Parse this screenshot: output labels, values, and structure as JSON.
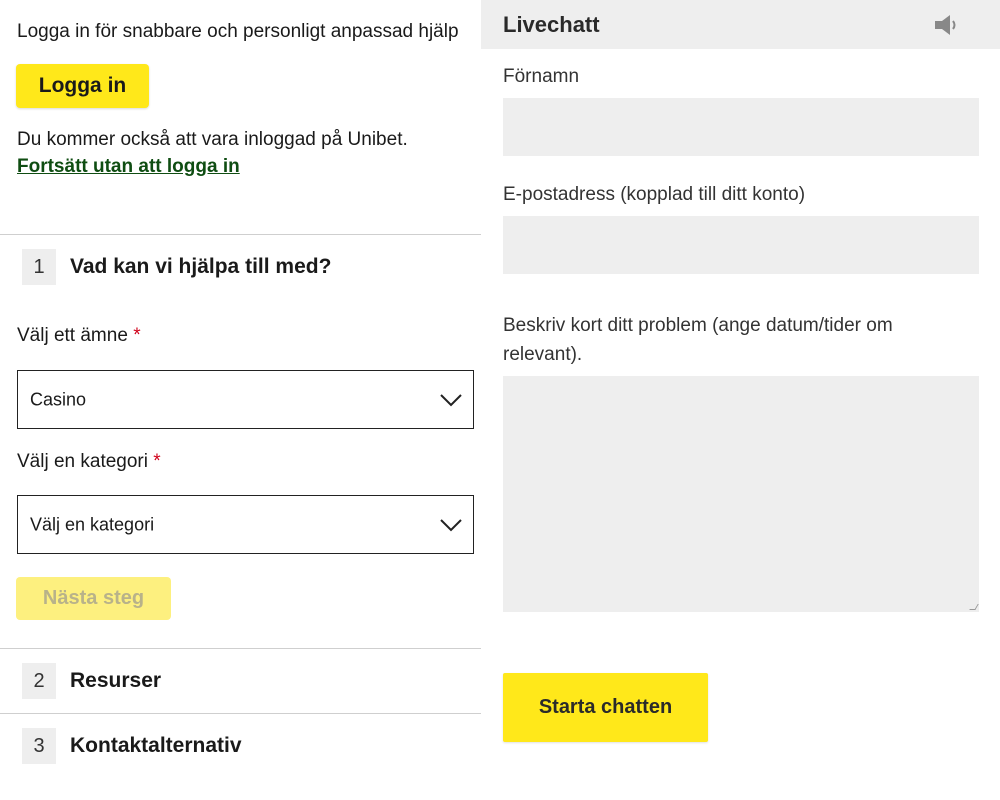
{
  "login_section": {
    "intro": "Logga in för snabbare och personligt anpassad hjälp",
    "login_button": "Logga in",
    "also_logged_in": "Du kommer också att vara inloggad på Unibet.",
    "continue_link": "Fortsätt utan att logga in"
  },
  "steps": [
    {
      "number": "1",
      "title": "Vad kan vi hjälpa till med?"
    },
    {
      "number": "2",
      "title": "Resurser"
    },
    {
      "number": "3",
      "title": "Kontaktalternativ"
    }
  ],
  "step1": {
    "topic_label": "Välj ett ämne",
    "topic_value": "Casino",
    "category_label": "Välj en kategori",
    "category_value": "Välj en kategori",
    "required_mark": "*",
    "next_button": "Nästa steg"
  },
  "chat": {
    "title": "Livechatt",
    "speaker_icon": "speaker-icon",
    "first_name_label": "Förnamn",
    "first_name_value": "",
    "email_label": "E-postadress (kopplad till ditt konto)",
    "email_value": "",
    "problem_label_line1": "Beskriv kort ditt problem (ange datum/tider om",
    "problem_label_line2": "relevant).",
    "problem_value": "",
    "start_button": "Starta chatten"
  },
  "colors": {
    "accent_yellow": "#ffe81a",
    "disabled_yellow": "#fdf07f",
    "link_green": "#0f4d12",
    "required_red": "#d0021b",
    "field_gray": "#eeeeee"
  }
}
